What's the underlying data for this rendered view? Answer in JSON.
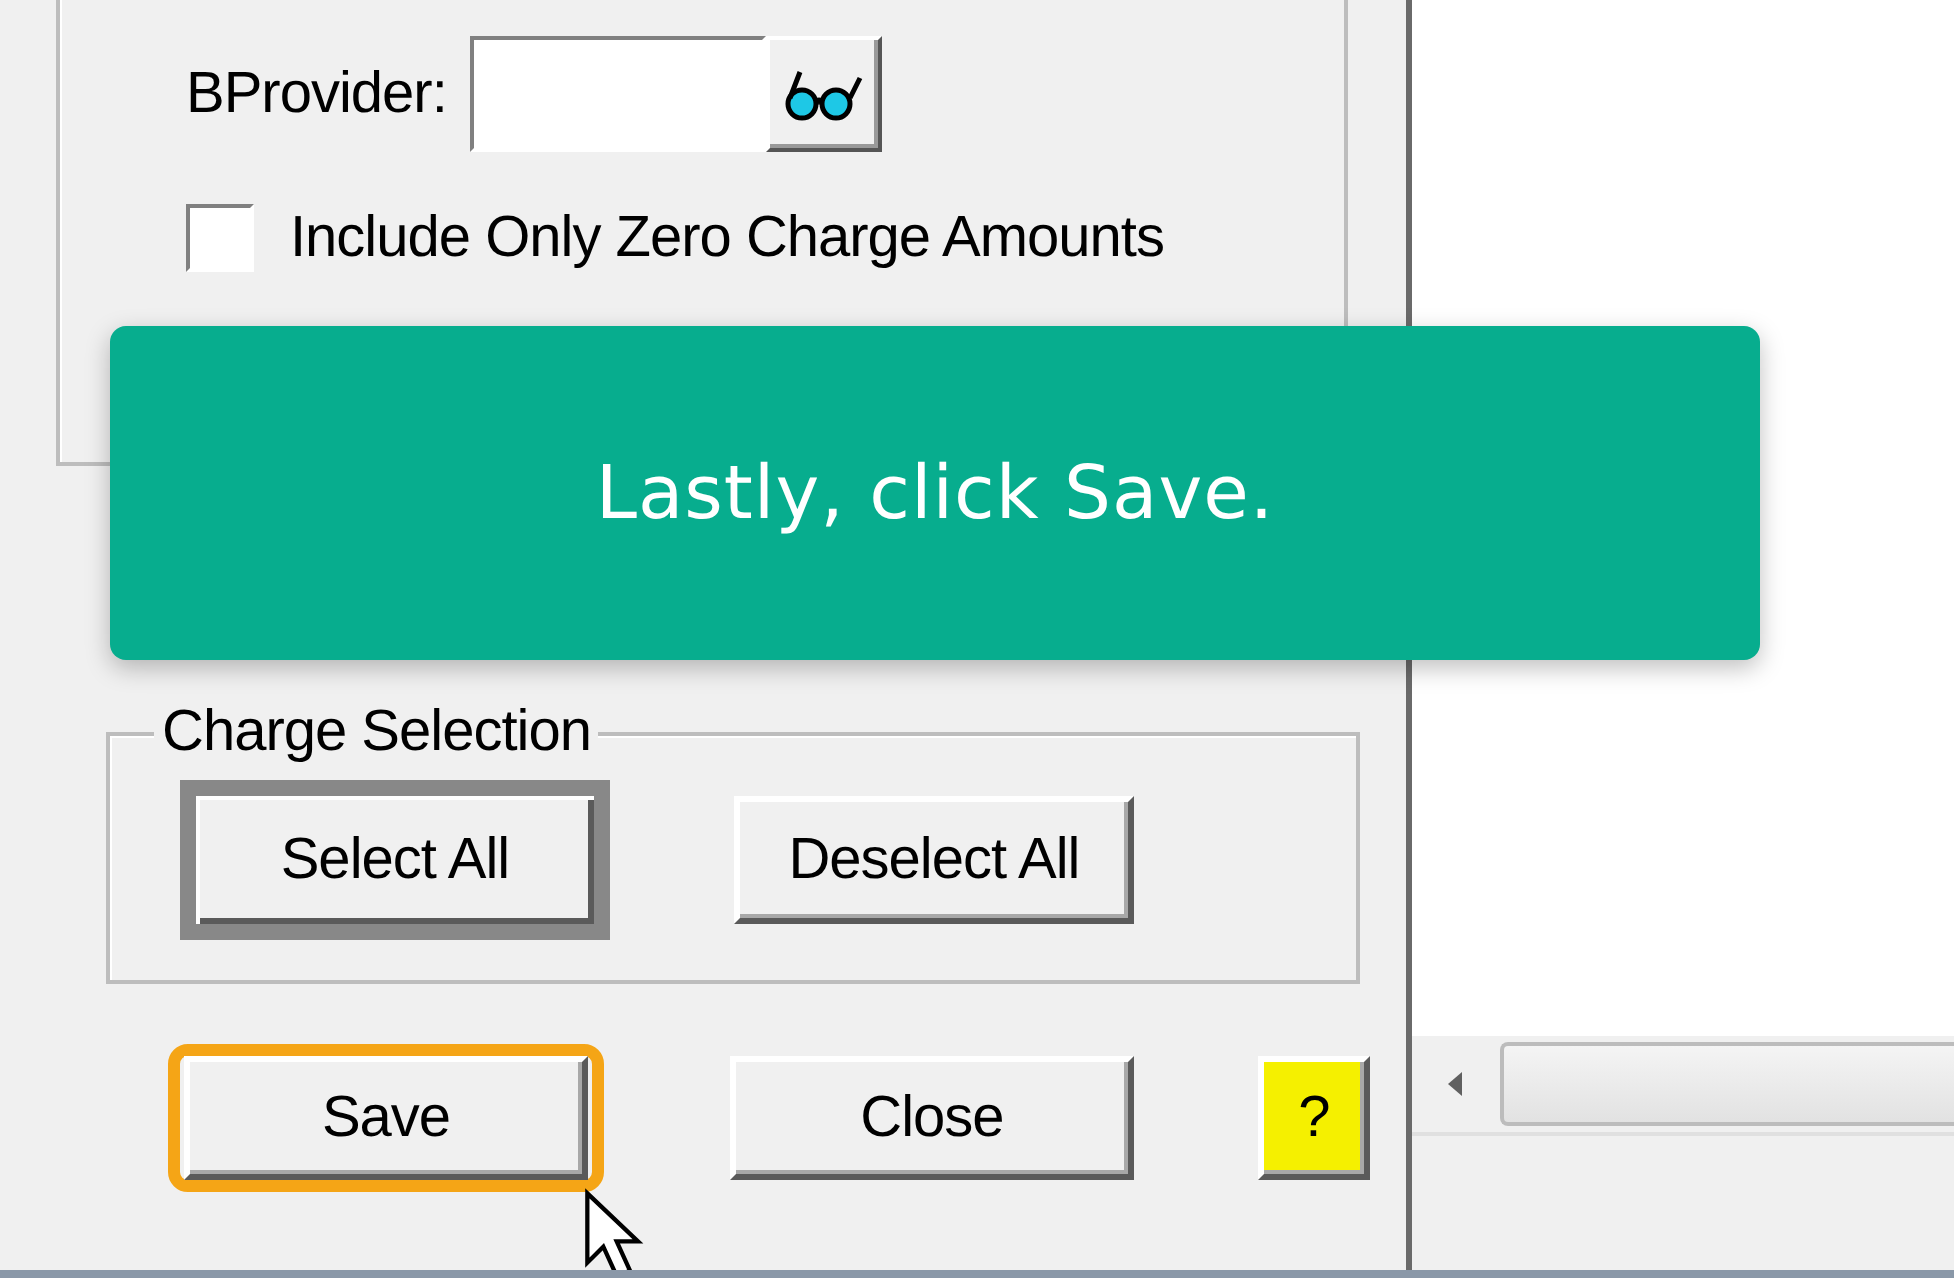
{
  "filter_group": {
    "provider_field": {
      "label": "BProvider:"
    },
    "zero_charge_checkbox": {
      "label": "Include Only Zero Charge Amounts",
      "checked": false
    }
  },
  "charge_selection": {
    "title": "Charge Selection",
    "buttons": [
      {
        "label": "Select All",
        "default": true
      },
      {
        "label": "Deselect All",
        "default": false
      }
    ]
  },
  "actions": [
    {
      "kind": "button",
      "label": "Save",
      "highlighted": true
    },
    {
      "kind": "button",
      "label": "Close",
      "highlighted": false
    },
    {
      "kind": "help",
      "label": "?",
      "highlighted": false
    }
  ],
  "tooltip": {
    "text": "Lastly, click Save."
  }
}
